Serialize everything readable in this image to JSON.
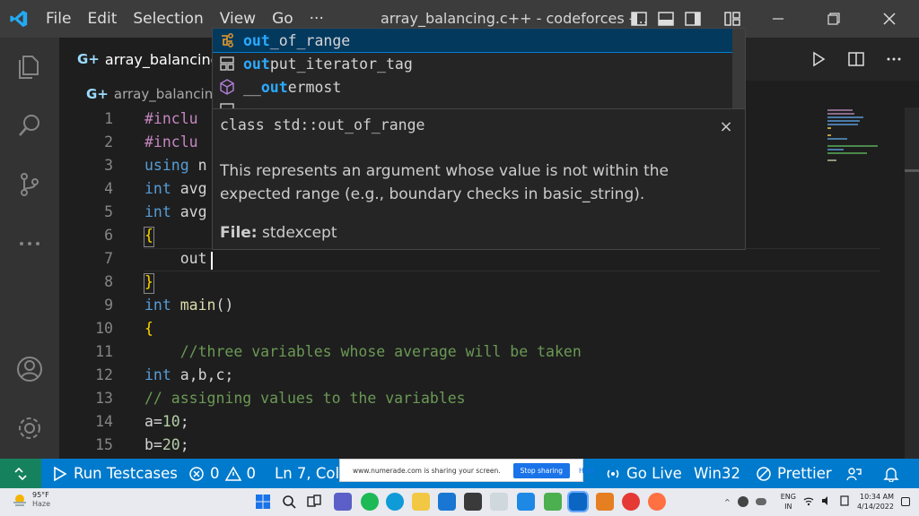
{
  "titlebar": {
    "menu": [
      "File",
      "Edit",
      "Selection",
      "View",
      "Go",
      "···"
    ],
    "title": "array_balancing.c++ - codeforces -..."
  },
  "tab": {
    "label": "array_balancing"
  },
  "breadcrumb": {
    "label": "array_balancin"
  },
  "editor": {
    "lines": [
      {
        "n": "1",
        "parts": [
          {
            "c": "pp",
            "t": "#inclu"
          }
        ]
      },
      {
        "n": "2",
        "parts": [
          {
            "c": "pp",
            "t": "#inclu"
          }
        ]
      },
      {
        "n": "3",
        "parts": [
          {
            "c": "kw",
            "t": "using"
          },
          {
            "c": "tx",
            "t": " n"
          }
        ]
      },
      {
        "n": "4",
        "parts": [
          {
            "c": "kw",
            "t": "int"
          },
          {
            "c": "tx",
            "t": " avg"
          }
        ]
      },
      {
        "n": "5",
        "parts": [
          {
            "c": "kw",
            "t": "int"
          },
          {
            "c": "tx",
            "t": " avg"
          }
        ]
      },
      {
        "n": "6",
        "parts": [
          {
            "c": "br",
            "t": "{"
          }
        ]
      },
      {
        "n": "7",
        "parts": [
          {
            "c": "tx",
            "t": "    out"
          }
        ]
      },
      {
        "n": "8",
        "parts": [
          {
            "c": "br",
            "t": "}"
          }
        ]
      },
      {
        "n": "9",
        "parts": [
          {
            "c": "kw",
            "t": "int"
          },
          {
            "c": "tx",
            "t": " "
          },
          {
            "c": "fn",
            "t": "main"
          },
          {
            "c": "tx",
            "t": "()"
          }
        ]
      },
      {
        "n": "10",
        "parts": [
          {
            "c": "br",
            "t": "{"
          }
        ]
      },
      {
        "n": "11",
        "parts": [
          {
            "c": "cm",
            "t": "    //three variables whose average will be taken"
          }
        ]
      },
      {
        "n": "12",
        "parts": [
          {
            "c": "kw",
            "t": "int"
          },
          {
            "c": "tx",
            "t": " a,b,c;"
          }
        ]
      },
      {
        "n": "13",
        "parts": [
          {
            "c": "cm",
            "t": "// assigning values to the variables"
          }
        ]
      },
      {
        "n": "14",
        "parts": [
          {
            "c": "tx",
            "t": "a="
          },
          {
            "c": "nm",
            "t": "10"
          },
          {
            "c": "tx",
            "t": ";"
          }
        ]
      },
      {
        "n": "15",
        "parts": [
          {
            "c": "tx",
            "t": "b="
          },
          {
            "c": "nm",
            "t": "20"
          },
          {
            "c": "tx",
            "t": ";"
          }
        ]
      }
    ]
  },
  "suggest": {
    "items": [
      {
        "match": "out",
        "rest": "_of_range",
        "icon": "class-icon",
        "selected": true
      },
      {
        "match": "out",
        "rest": "put_iterator_tag",
        "icon": "struct-icon",
        "selected": false
      },
      {
        "pre": "__",
        "match": "out",
        "rest": "ermost",
        "icon": "module-icon",
        "selected": false
      },
      {
        "match": "",
        "rest": "",
        "icon": "struct-icon",
        "selected": false
      }
    ]
  },
  "details": {
    "signature": "class std::out_of_range",
    "doc": "This represents an argument whose value is not within the expected range (e.g., boundary checks in basic_string).",
    "file_label": "File:",
    "file_value": " stdexcept",
    "close": "×"
  },
  "statusbar": {
    "run_testcases": "Run Testcases",
    "errors": "0",
    "warnings": "0",
    "position": "Ln 7, Col",
    "go_live": "Go Live",
    "platform": "Win32",
    "prettier": "Prettier"
  },
  "share_banner": {
    "text": "www.numerade.com is sharing your screen.",
    "stop": "Stop sharing",
    "hide": "Hide"
  },
  "taskbar": {
    "temp": "95°F",
    "condition": "Haze",
    "lang_top": "ENG",
    "lang_bottom": "IN",
    "time": "10:34 AM",
    "date": "4/14/2022"
  }
}
